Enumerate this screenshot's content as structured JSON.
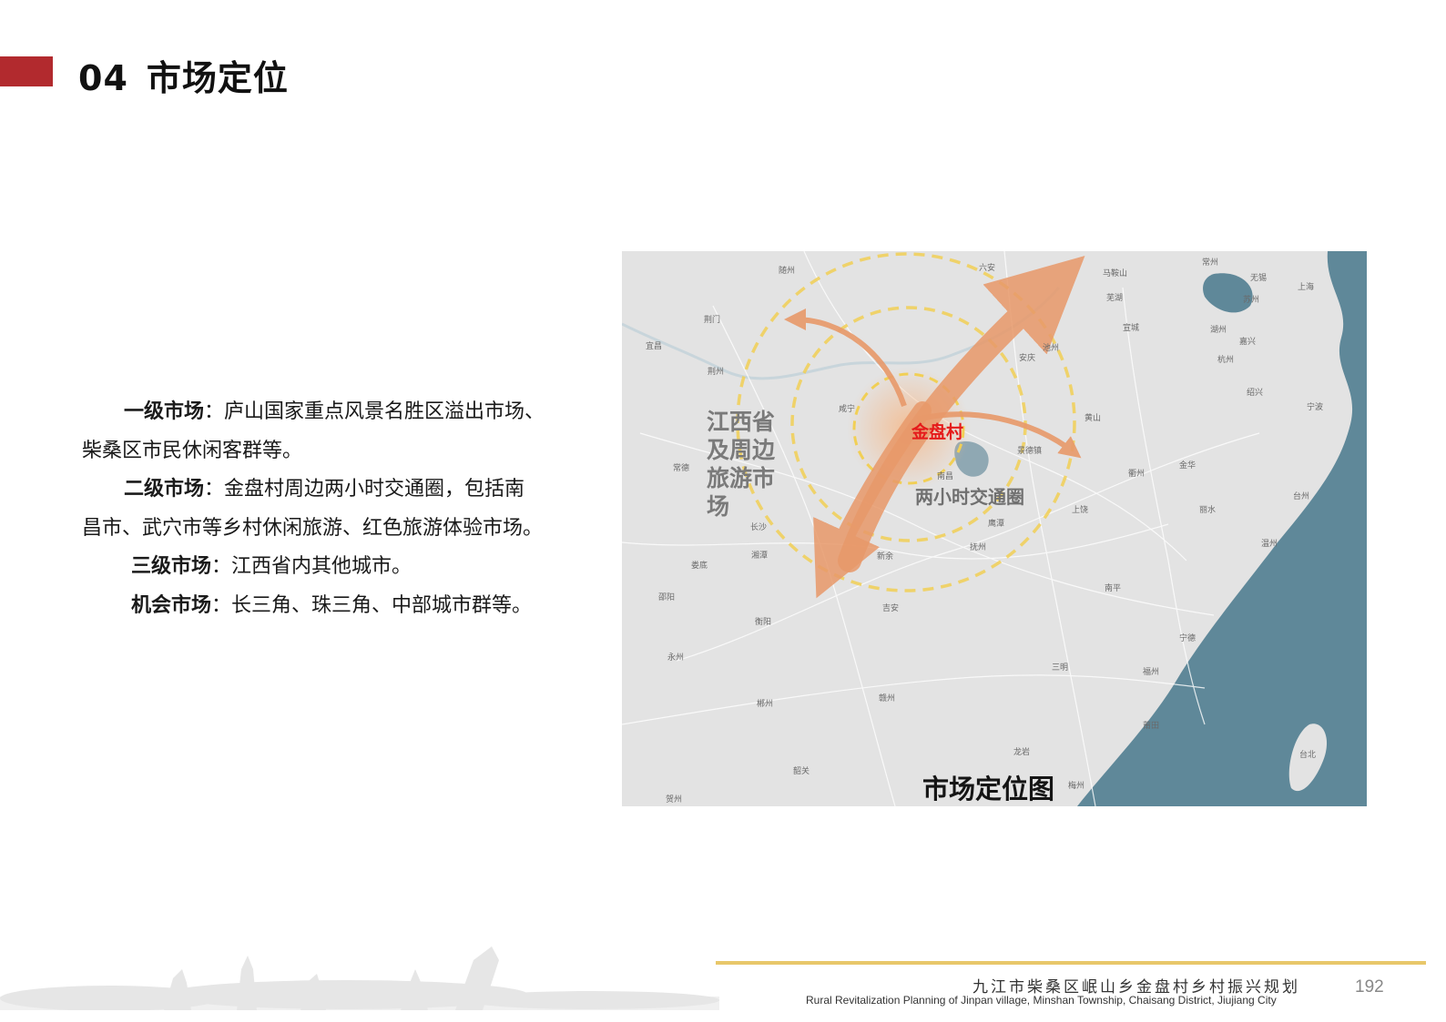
{
  "header": {
    "number": "04",
    "title": "市场定位"
  },
  "markets": [
    {
      "label": "一级市场",
      "sep": "：",
      "lines": [
        "庐山国家重点风景名胜区溢出市场、",
        "柴桑区市民休闲客群等。"
      ]
    },
    {
      "label": "二级市场",
      "sep": "：",
      "lines": [
        "金盘村周边两小时交通圈，包括南",
        "昌市、武穴市等乡村休闲旅游、红色旅游体验市场。"
      ]
    },
    {
      "label": "三级市场",
      "sep": "：",
      "lines": [
        "江西省内其他城市。"
      ]
    },
    {
      "label": "机会市场",
      "sep": "：",
      "lines": [
        "长三角、珠三角、中部城市群等。"
      ]
    }
  ],
  "map": {
    "region_label": "江西省及周边旅游市场",
    "circle_label": "两小时交通圈",
    "village_label": "金盘村",
    "caption": "市场定位图",
    "colors": {
      "land": "#e3e3e3",
      "sea": "#5f8899",
      "ring": "#f1cf55",
      "arrow": "#e8996a",
      "village": "#e51a1a"
    },
    "cities": [
      "随州",
      "六安",
      "马鞍山",
      "常州",
      "无锡",
      "上海",
      "荆门",
      "宜昌",
      "荆州",
      "芜湖",
      "苏州",
      "宣城",
      "湖州",
      "嘉兴",
      "池州",
      "安庆",
      "杭州",
      "绍兴",
      "咸宁",
      "黄山",
      "宁波",
      "景德镇",
      "常德",
      "南昌",
      "衢州",
      "金华",
      "上饶",
      "台州",
      "丽水",
      "长沙",
      "鹰潭",
      "抚州",
      "温州",
      "湘潭",
      "新余",
      "娄底",
      "吉安",
      "南平",
      "邵阳",
      "衡阳",
      "宁德",
      "永州",
      "三明",
      "福州",
      "郴州",
      "赣州",
      "莆田",
      "龙岩",
      "台北",
      "韶关",
      "梅州",
      "贺州"
    ]
  },
  "footer": {
    "title_cn": "九江市柴桑区岷山乡金盘村乡村振兴规划",
    "title_en": "Rural Revitalization Planning of Jinpan village, Minshan Township, Chaisang District, Jiujiang City",
    "page": "192"
  }
}
